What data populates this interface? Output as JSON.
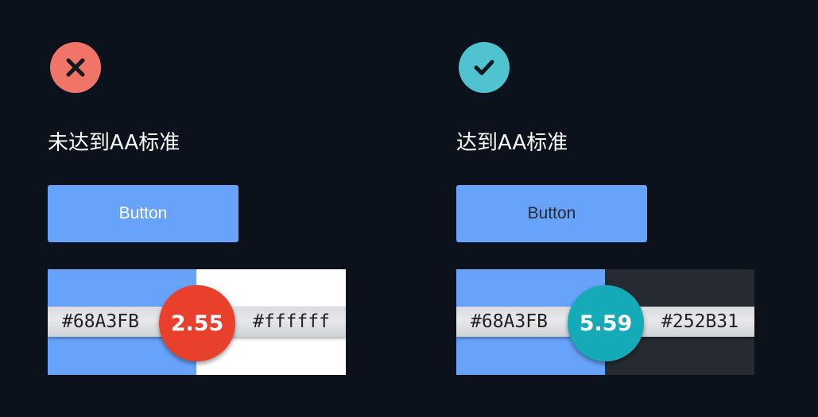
{
  "fail": {
    "icon": "x-icon",
    "icon_color": "#f07568",
    "verdict": "未达到AA标准",
    "button": {
      "label": "Button",
      "background": "#68A3FB",
      "text_color": "#ffffff"
    },
    "contrast": {
      "foreground_code": "#68A3FB",
      "background_code": "#ffffff",
      "foreground_color": "#68A3FB",
      "background_color": "#ffffff",
      "ratio": "2.55",
      "ratio_badge_color": "#e8402a"
    }
  },
  "pass": {
    "icon": "checkmark-icon",
    "icon_color": "#4fc3cf",
    "verdict": "达到AA标准",
    "button": {
      "label": "Button",
      "background": "#68A3FB",
      "text_color": "#252B31"
    },
    "contrast": {
      "foreground_code": "#68A3FB",
      "background_code": "#252B31",
      "foreground_color": "#68A3FB",
      "background_color": "#252B31",
      "ratio": "5.59",
      "ratio_badge_color": "#14aab7"
    }
  }
}
